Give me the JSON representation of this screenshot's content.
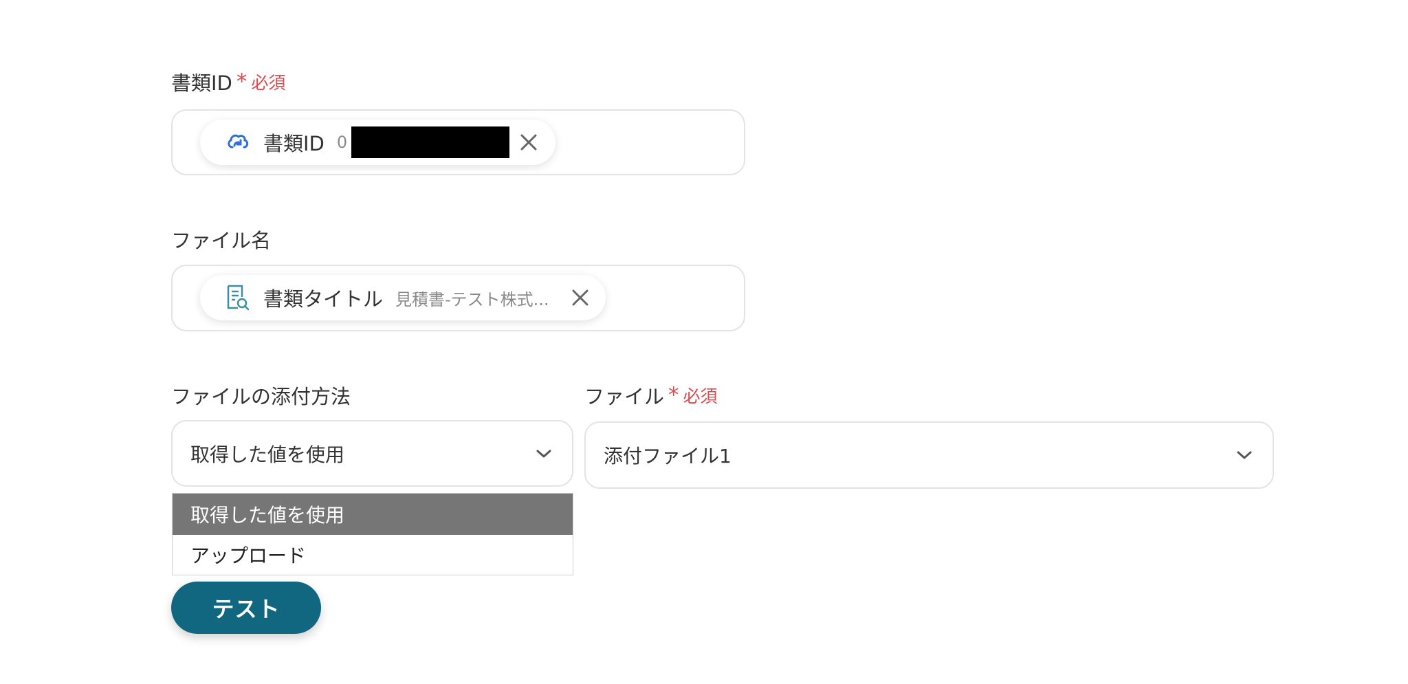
{
  "doc_id_field": {
    "label": "書類ID",
    "required_mark": "*",
    "required_text": "必須",
    "chip": {
      "icon": "cloud-sync-icon",
      "title": "書類ID",
      "value_prefix": "0"
    }
  },
  "filename_field": {
    "label": "ファイル名",
    "chip": {
      "icon": "document-search-icon",
      "title": "書類タイトル",
      "value": "見積書-テスト株式..."
    }
  },
  "attach_method_field": {
    "label": "ファイルの添付方法",
    "selected": "取得した値を使用",
    "options": [
      "取得した値を使用",
      "アップロード"
    ]
  },
  "file_field": {
    "label": "ファイル",
    "required_mark": "*",
    "required_text": "必須",
    "selected": "添付ファイル1"
  },
  "test_button": {
    "label": "テスト"
  },
  "colors": {
    "accent": "#11677f",
    "required": "#e5484d",
    "dropdown_selected": "#767676"
  }
}
